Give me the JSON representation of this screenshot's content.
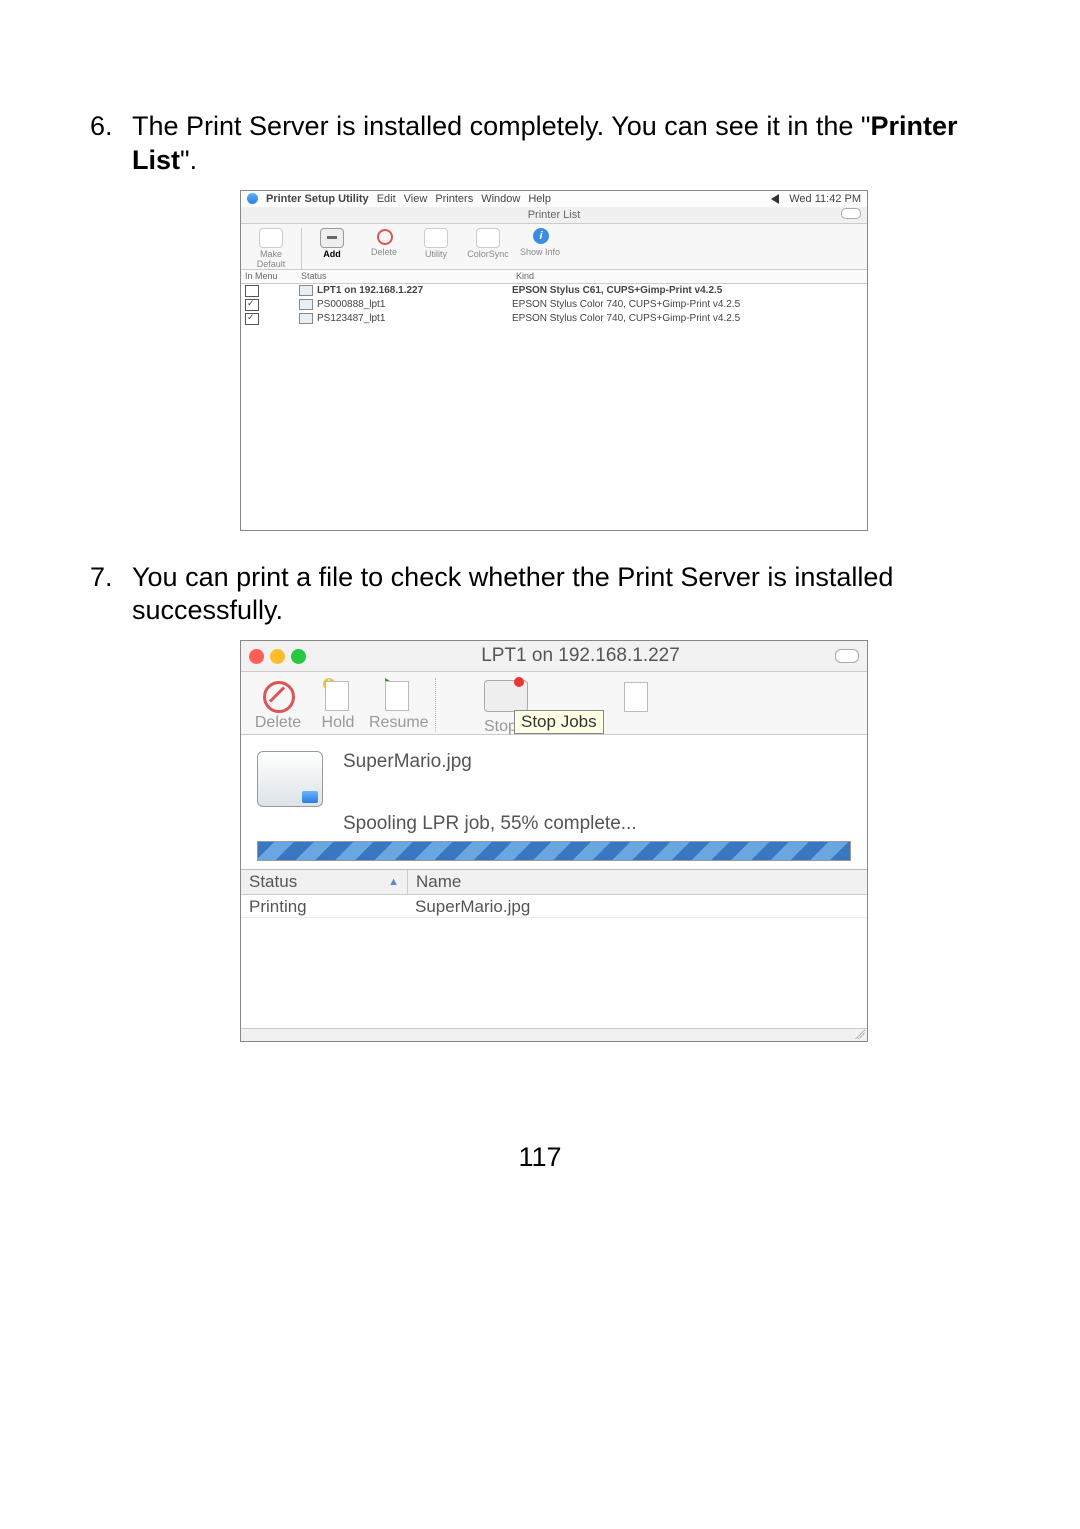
{
  "step6": {
    "num": "6.",
    "text_a": "The Print Server is installed completely. You can see it in the \"",
    "text_b": "Printer List",
    "text_c": "\"."
  },
  "step7": {
    "num": "7.",
    "text": "You can print a file to check whether the Print Server is installed successfully."
  },
  "fig1": {
    "menubar": {
      "app": "Printer Setup Utility",
      "items": [
        "Edit",
        "View",
        "Printers",
        "Window",
        "Help"
      ],
      "clock": "Wed 11:42 PM"
    },
    "window_title": "Printer List",
    "toolbar": {
      "make_default": "Make Default",
      "add": "Add",
      "delete": "Delete",
      "utility": "Utility",
      "colorsync": "ColorSync",
      "showinfo": "Show Info"
    },
    "columns": {
      "in_menu": "In Menu",
      "status": "Status",
      "kind": "Kind"
    },
    "rows": [
      {
        "name": "LPT1 on 192.168.1.227",
        "kind": "EPSON Stylus C61, CUPS+Gimp-Print v4.2.5",
        "checked": false,
        "highlighted": true
      },
      {
        "name": "PS000888_lpt1",
        "kind": "EPSON Stylus Color 740, CUPS+Gimp-Print v4.2.5",
        "checked": true
      },
      {
        "name": "PS123487_lpt1",
        "kind": "EPSON Stylus Color 740, CUPS+Gimp-Print v4.2.5",
        "checked": true
      }
    ]
  },
  "fig2": {
    "title": "LPT1 on 192.168.1.227",
    "toolbar": {
      "delete": "Delete",
      "hold": "Hold",
      "resume": "Resume",
      "stop_short": "Stop Jc",
      "stop_tooltip": "Stop Jobs"
    },
    "file_name": "SuperMario.jpg",
    "status_line": "Spooling LPR job, 55% complete...",
    "progress_percent": 55,
    "table": {
      "col_status": "Status",
      "col_name": "Name",
      "rows": [
        {
          "status": "Printing",
          "name": "SuperMario.jpg"
        }
      ]
    }
  },
  "page_number": "117"
}
